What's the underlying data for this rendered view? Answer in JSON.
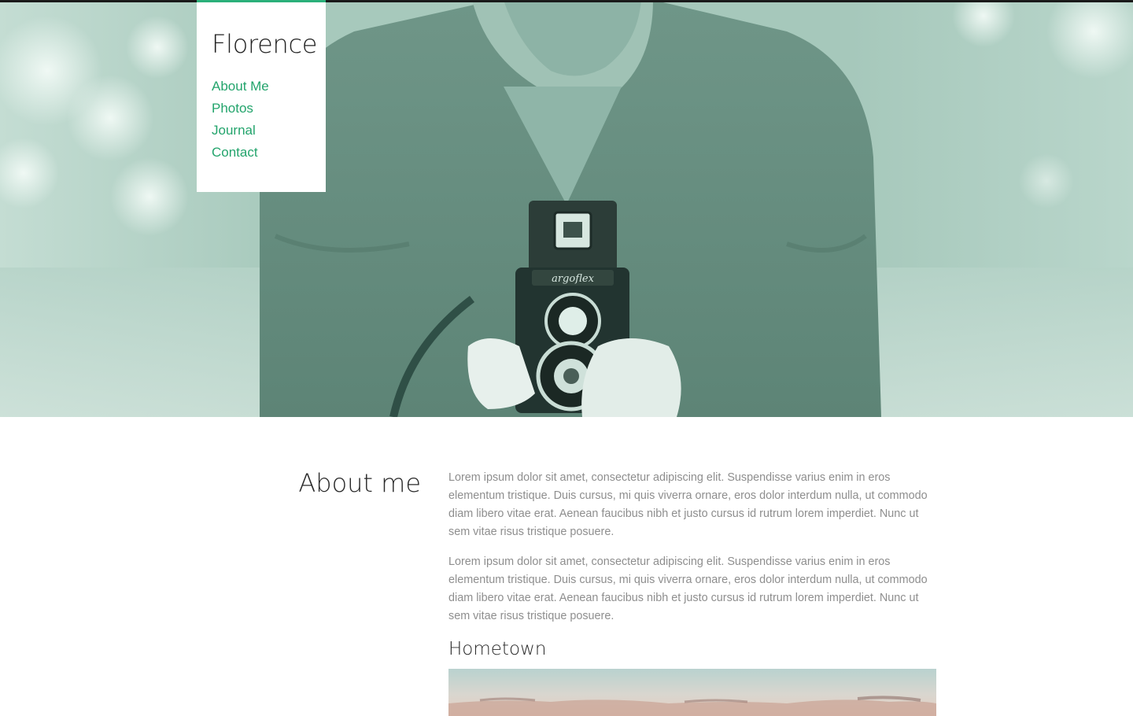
{
  "site": {
    "brand": "Florence"
  },
  "nav": {
    "items": [
      {
        "label": "About Me"
      },
      {
        "label": "Photos"
      },
      {
        "label": "Journal"
      },
      {
        "label": "Contact"
      }
    ]
  },
  "hero": {
    "image_caption_text": "argoflex"
  },
  "about": {
    "title": "About me",
    "paragraphs": [
      "Lorem ipsum dolor sit amet, consectetur adipiscing elit. Suspendisse varius enim in eros elementum tristique. Duis cursus, mi quis viverra ornare, eros dolor interdum nulla, ut commodo diam libero vitae erat. Aenean faucibus nibh et justo cursus id rutrum lorem imperdiet. Nunc ut sem vitae risus tristique posuere.",
      "Lorem ipsum dolor sit amet, consectetur adipiscing elit. Suspendisse varius enim in eros elementum tristique. Duis cursus, mi quis viverra ornare, eros dolor interdum nulla, ut commodo diam libero vitae erat. Aenean faucibus nibh et justo cursus id rutrum lorem imperdiet. Nunc ut sem vitae risus tristique posuere."
    ],
    "subheading": "Hometown"
  },
  "colors": {
    "accent": "#23a46c",
    "accent_bar": "#2bb07a",
    "hero_tint": "#a9cbbf",
    "body_text": "#8e8e8e",
    "heading_text": "#2a2a2a"
  }
}
